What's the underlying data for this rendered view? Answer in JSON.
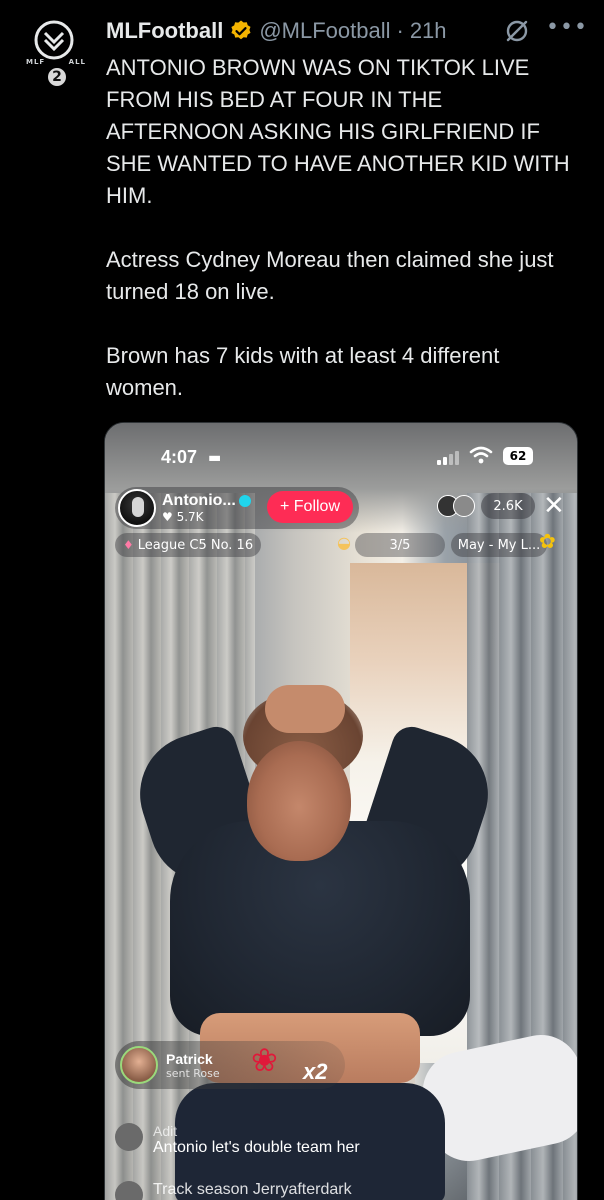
{
  "tweet": {
    "display_name": "MLFootball",
    "handle": "@MLFootball",
    "separator": "·",
    "time": "21h",
    "avatar_badge": "2",
    "avatar_ring_left": "MLF",
    "avatar_ring_right": "ALL",
    "paragraphs": [
      "ANTONIO BROWN WAS ON TIKTOK LIVE FROM HIS BED AT FOUR IN THE AFTERNOON ASKING HIS GIRLFRIEND IF SHE WANTED TO HAVE ANOTHER KID WITH HIM.",
      "Actress Cydney Moreau then claimed she just turned 18 on live.",
      "Brown has 7 kids with at least 4 different women."
    ],
    "more": "•••"
  },
  "live": {
    "status_time": "4:07",
    "battery": "62",
    "host_name": "Antonio...",
    "host_likes": "♥ 5.7K",
    "follow_label": "+ Follow",
    "viewer_count": "2.6K",
    "close": "✕",
    "league": "League C5 No. 16",
    "progress": "3/5",
    "may": "May - My L...",
    "gift_user": "Patrick",
    "gift_action": "sent Rose",
    "gift_combo": "x2",
    "comments": [
      {
        "user": "Adit",
        "text": "Antonio let's double team her"
      },
      {
        "user": "",
        "text": "Track season Jerryafterdark"
      }
    ]
  },
  "colors": {
    "background": "#000000",
    "text": "#e7e9ea",
    "muted": "#8b98a5",
    "verified": "#f4b400",
    "follow": "#fe2c55"
  }
}
